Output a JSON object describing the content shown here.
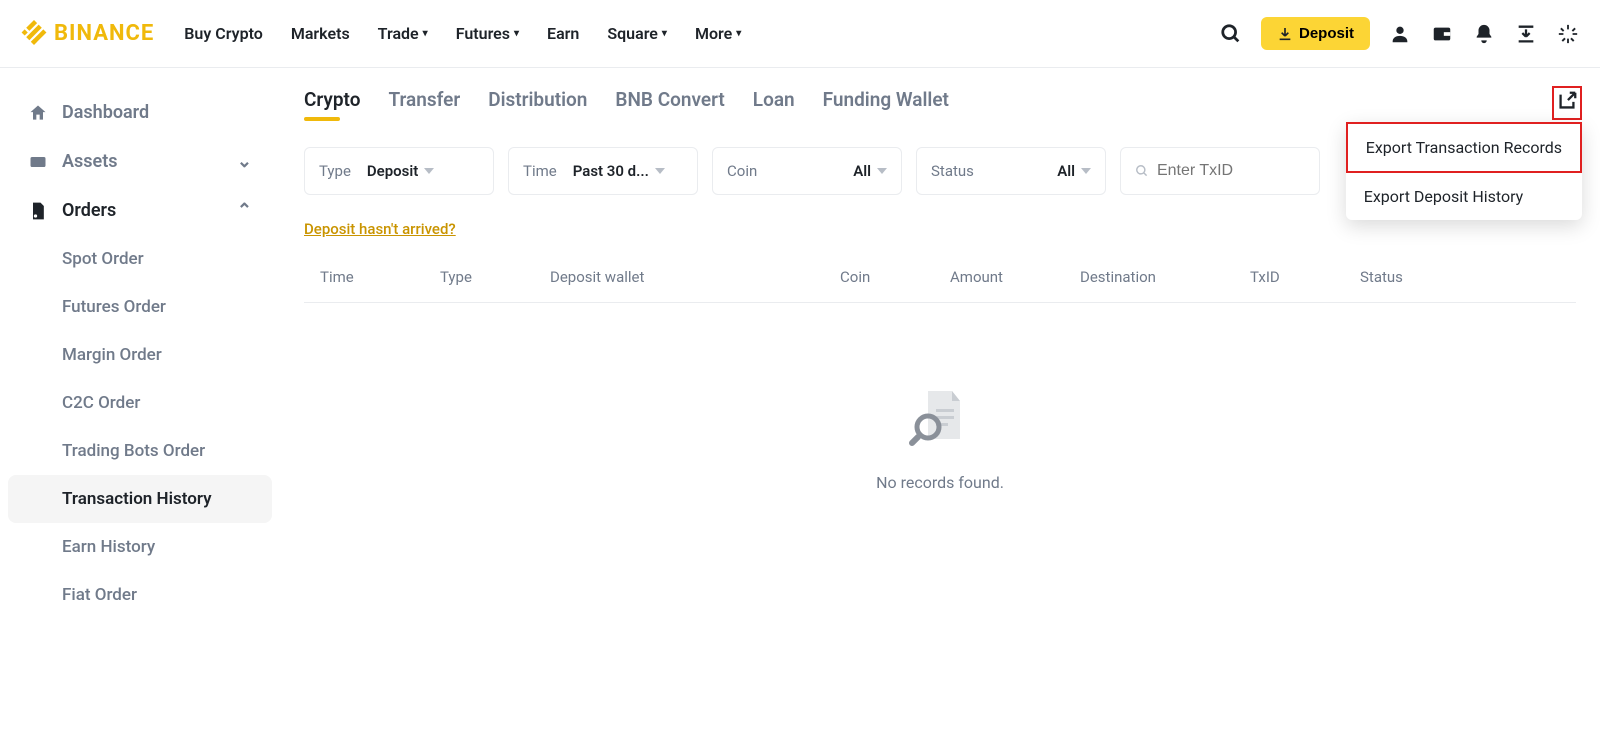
{
  "brand": "BINANCE",
  "nav": {
    "buy": "Buy Crypto",
    "markets": "Markets",
    "trade": "Trade",
    "futures": "Futures",
    "earn": "Earn",
    "square": "Square",
    "more": "More"
  },
  "header": {
    "deposit": "Deposit"
  },
  "sidebar": {
    "dashboard": "Dashboard",
    "assets": "Assets",
    "orders": "Orders",
    "items": {
      "spot": "Spot Order",
      "futures": "Futures Order",
      "margin": "Margin Order",
      "c2c": "C2C Order",
      "bots": "Trading Bots Order",
      "tx": "Transaction History",
      "earn": "Earn History",
      "fiat": "Fiat Order"
    }
  },
  "tabs": {
    "crypto": "Crypto",
    "transfer": "Transfer",
    "distribution": "Distribution",
    "bnb": "BNB Convert",
    "loan": "Loan",
    "funding": "Funding Wallet"
  },
  "filters": {
    "type_label": "Type",
    "type_value": "Deposit",
    "time_label": "Time",
    "time_value": "Past 30 d...",
    "coin_label": "Coin",
    "coin_value": "All",
    "status_label": "Status",
    "status_value": "All",
    "search_placeholder": "Enter TxID"
  },
  "help_link": "Deposit hasn't arrived?",
  "table": {
    "time": "Time",
    "type": "Type",
    "wallet": "Deposit wallet",
    "coin": "Coin",
    "amount": "Amount",
    "dest": "Destination",
    "txid": "TxID",
    "status": "Status"
  },
  "empty": "No records found.",
  "export": {
    "tx": "Export Transaction Records",
    "dep": "Export Deposit History"
  }
}
